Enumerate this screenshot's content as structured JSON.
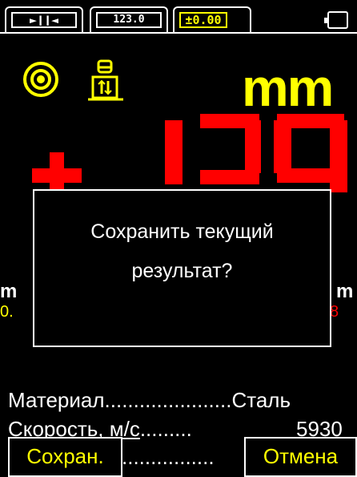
{
  "tabs": [
    {
      "name": "tab-gap",
      "glyph": "►❙❙◄"
    },
    {
      "name": "tab-numeric",
      "glyph": "123.0"
    },
    {
      "name": "tab-deviation",
      "glyph": "±0.00"
    }
  ],
  "colors": {
    "accent": "#ffff00",
    "reading": "#ff0000",
    "bg": "#000000",
    "fg": "#ffffff"
  },
  "main": {
    "unit": "mm",
    "reading_sign": "+",
    "left_unit": "m",
    "left_value": "0.",
    "right_unit": "m",
    "right_value": "8"
  },
  "dialog": {
    "line1": "Сохранить текущий",
    "line2": "результат?"
  },
  "info": {
    "material_label": "Материал",
    "material_dots": "......................",
    "material_value": "Сталь",
    "speed_label": "Скорость, м/с",
    "speed_dots": ".........",
    "speed_value": "5930",
    "bottom_dots": "................"
  },
  "softkeys": {
    "save": "Сохран.",
    "cancel": "Отмена"
  }
}
